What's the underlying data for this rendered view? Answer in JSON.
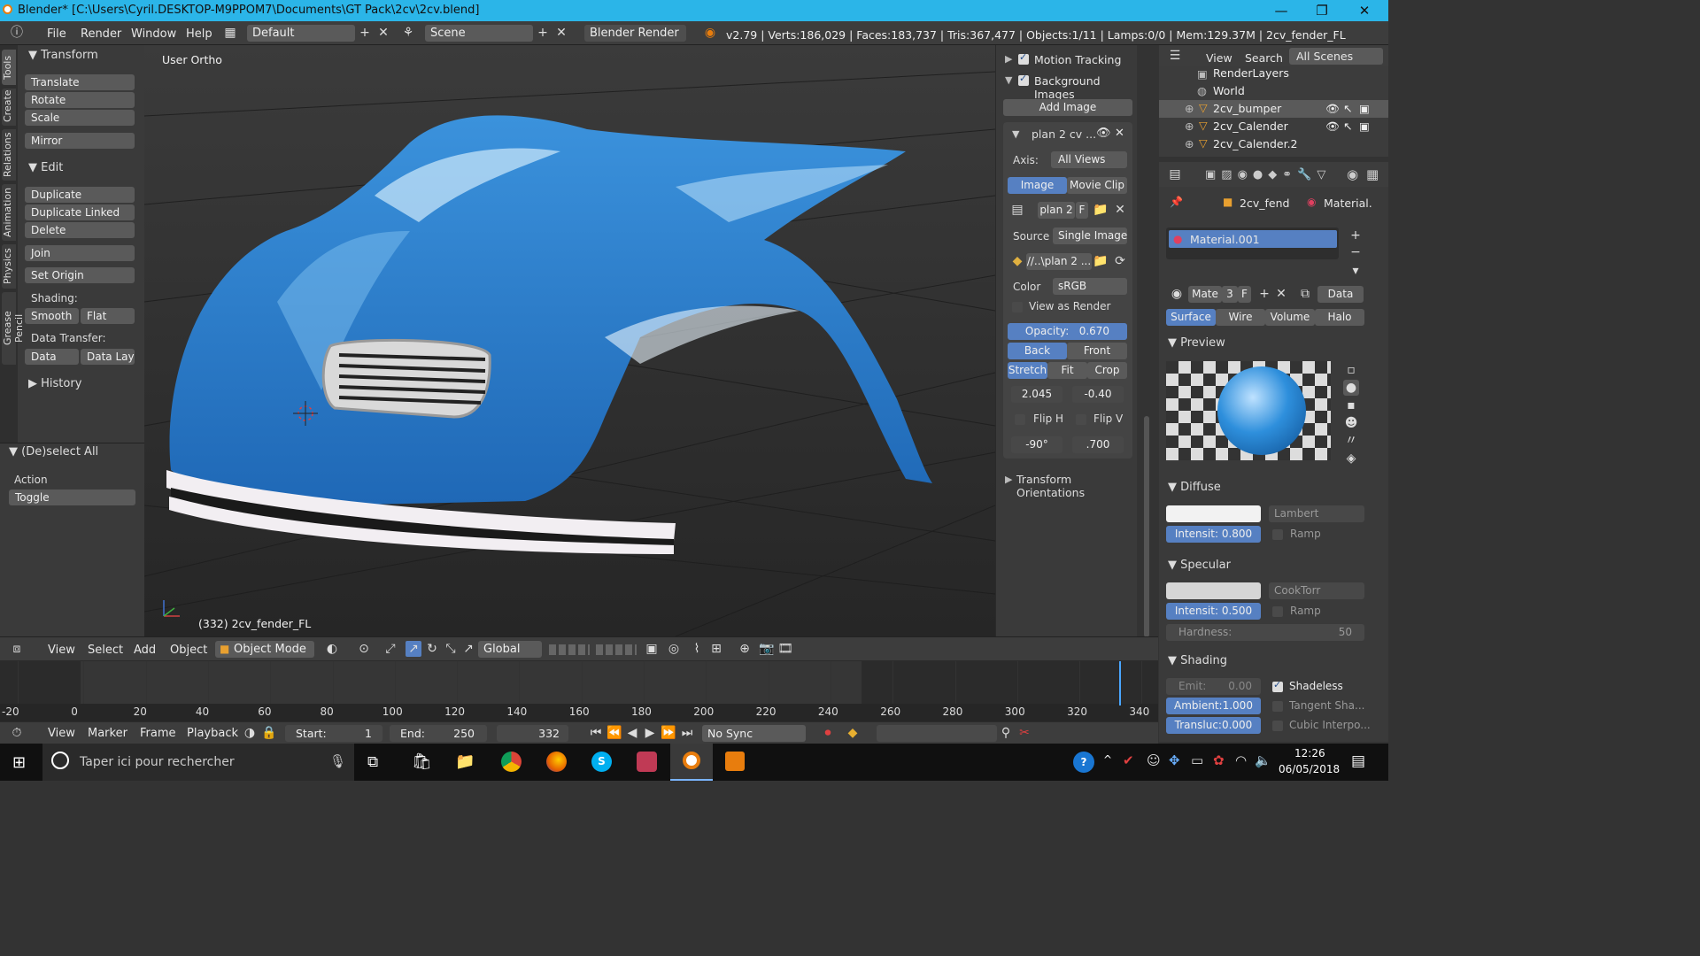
{
  "titlebar": {
    "title": "Blender* [C:\\Users\\Cyril.DESKTOP-M9PPOM7\\Documents\\GT Pack\\2cv\\2cv.blend]",
    "minimize": "—",
    "maximize": "❐",
    "close": "✕"
  },
  "infobar": {
    "menus": [
      "File",
      "Render",
      "Window",
      "Help"
    ],
    "layout": "Default",
    "scene": "Scene",
    "engine": "Blender Render",
    "stats": "v2.79 | Verts:186,029 | Faces:183,737 | Tris:367,477 | Objects:1/11 | Lamps:0/0 | Mem:129.37M | 2cv_fender_FL"
  },
  "tabs": [
    "Tools",
    "Create",
    "Relations",
    "Animation",
    "Physics",
    "Grease Pencil"
  ],
  "toolshelf": {
    "transform_header": "Transform",
    "transform": [
      "Translate",
      "Rotate",
      "Scale"
    ],
    "mirror": "Mirror",
    "edit_header": "Edit",
    "edit": [
      "Duplicate",
      "Duplicate Linked",
      "Delete"
    ],
    "join": "Join",
    "set_origin": "Set Origin",
    "shading_label": "Shading:",
    "smooth": "Smooth",
    "flat": "Flat",
    "data_transfer_label": "Data Transfer:",
    "data": "Data",
    "data_layo": "Data Layo",
    "history": "History",
    "deselect_header": "(De)select All",
    "action_label": "Action",
    "action_value": "Toggle"
  },
  "viewport": {
    "view_label": "User Ortho",
    "object_label": "(332) 2cv_fender_FL"
  },
  "npanel": {
    "motion_tracking": "Motion Tracking",
    "background_images": "Background Images",
    "add_image": "Add Image",
    "bg_name": "plan 2 cv ...",
    "axis_label": "Axis:",
    "axis_value": "All Views",
    "tab_image": "Image",
    "tab_movie": "Movie Clip",
    "image_name": "plan 2",
    "image_f": "F",
    "source_label": "Source",
    "source_value": "Single Image",
    "filepath": "//..\\plan 2 ...",
    "color_label": "Color",
    "color_value": "sRGB",
    "view_as_render": "View as Render",
    "opacity_label": "Opacity:",
    "opacity_value": "0.670",
    "back": "Back",
    "front": "Front",
    "stretch": "Stretch",
    "fit": "Fit",
    "crop": "Crop",
    "offset_x": "2.045",
    "offset_y": "-0.40",
    "flip_h": "Flip H",
    "flip_v": "Flip V",
    "rotation": "-90°",
    "size": ".700",
    "transform_orientations": "Transform Orientations"
  },
  "outliner": {
    "view": "View",
    "search": "Search",
    "all_scenes": "All Scenes",
    "items": [
      "RenderLayers",
      "World",
      "2cv_bumper",
      "2cv_Calender",
      "2cv_Calender.2"
    ]
  },
  "properties": {
    "object_name": "2cv_fend",
    "material_label": "Material.",
    "material_slot": "Material.001",
    "mat_name": "Mate",
    "mat_users": "3",
    "mat_f": "F",
    "data_btn": "Data",
    "tabs": [
      "Surface",
      "Wire",
      "Volume",
      "Halo"
    ],
    "preview": "Preview",
    "diffuse": "Diffuse",
    "diffuse_shader": "Lambert",
    "diffuse_intensity": "Intensit: 0.800",
    "ramp": "Ramp",
    "specular": "Specular",
    "specular_shader": "CookTorr",
    "specular_intensity": "Intensit: 0.500",
    "hardness": "Hardness:",
    "hardness_value": "50",
    "shading": "Shading",
    "emit": "Emit:",
    "emit_value": "0.00",
    "shadeless": "Shadeless",
    "ambient": "Ambient:1.000",
    "tangent": "Tangent Sha...",
    "transluc": "Transluc:0.000",
    "cubic": "Cubic Interpo..."
  },
  "view3d_header": {
    "menus": [
      "View",
      "Select",
      "Add",
      "Object"
    ],
    "mode": "Object Mode",
    "orientation": "Global"
  },
  "timeline": {
    "ticks": [
      "-20",
      "0",
      "20",
      "40",
      "60",
      "80",
      "100",
      "120",
      "140",
      "160",
      "180",
      "200",
      "220",
      "240",
      "260",
      "280",
      "300",
      "320",
      "340"
    ],
    "menus": [
      "View",
      "Marker",
      "Frame",
      "Playback"
    ],
    "start_label": "Start:",
    "start": "1",
    "end_label": "End:",
    "end": "250",
    "current": "332",
    "sync": "No Sync"
  },
  "taskbar": {
    "search_placeholder": "Taper ici pour rechercher",
    "time": "12:26",
    "date": "06/05/2018"
  },
  "colors": {
    "accent": "#5680c2",
    "titlebar": "#2bb5e8",
    "car_blue": "#2a7ccc"
  }
}
